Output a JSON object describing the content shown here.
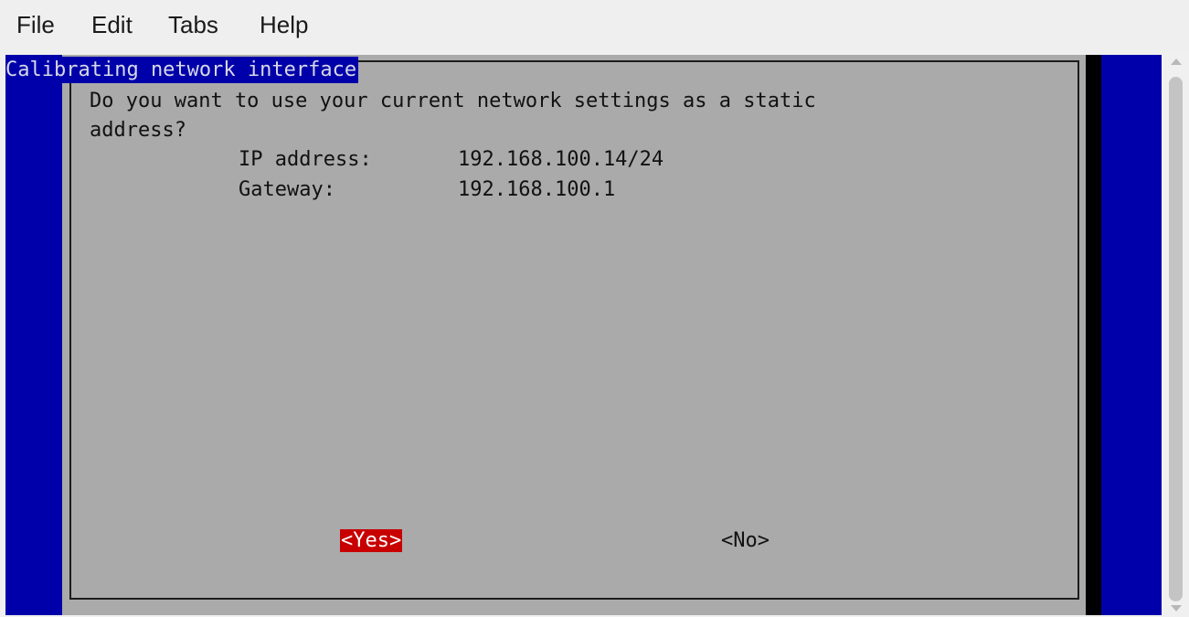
{
  "menu": {
    "file": "File",
    "edit": "Edit",
    "tabs": "Tabs",
    "help": "Help"
  },
  "dialog": {
    "title": "Calibrating network interface",
    "question_line1": "Do you want to use your current network settings as a static",
    "question_line2": "address?",
    "ip_label": "IP address:",
    "ip_value": "192.168.100.14/24",
    "gateway_label": "Gateway:",
    "gateway_value": "192.168.100.1",
    "yes_button": "<Yes>",
    "no_button": "<No>"
  },
  "colors": {
    "terminal_background": "#0000aa",
    "dialog_background": "#aaaaaa",
    "selected_button": "#c80000"
  },
  "icons": {
    "scroll_up": "scroll-up-arrow-icon",
    "scroll_down": "scroll-down-arrow-icon"
  }
}
